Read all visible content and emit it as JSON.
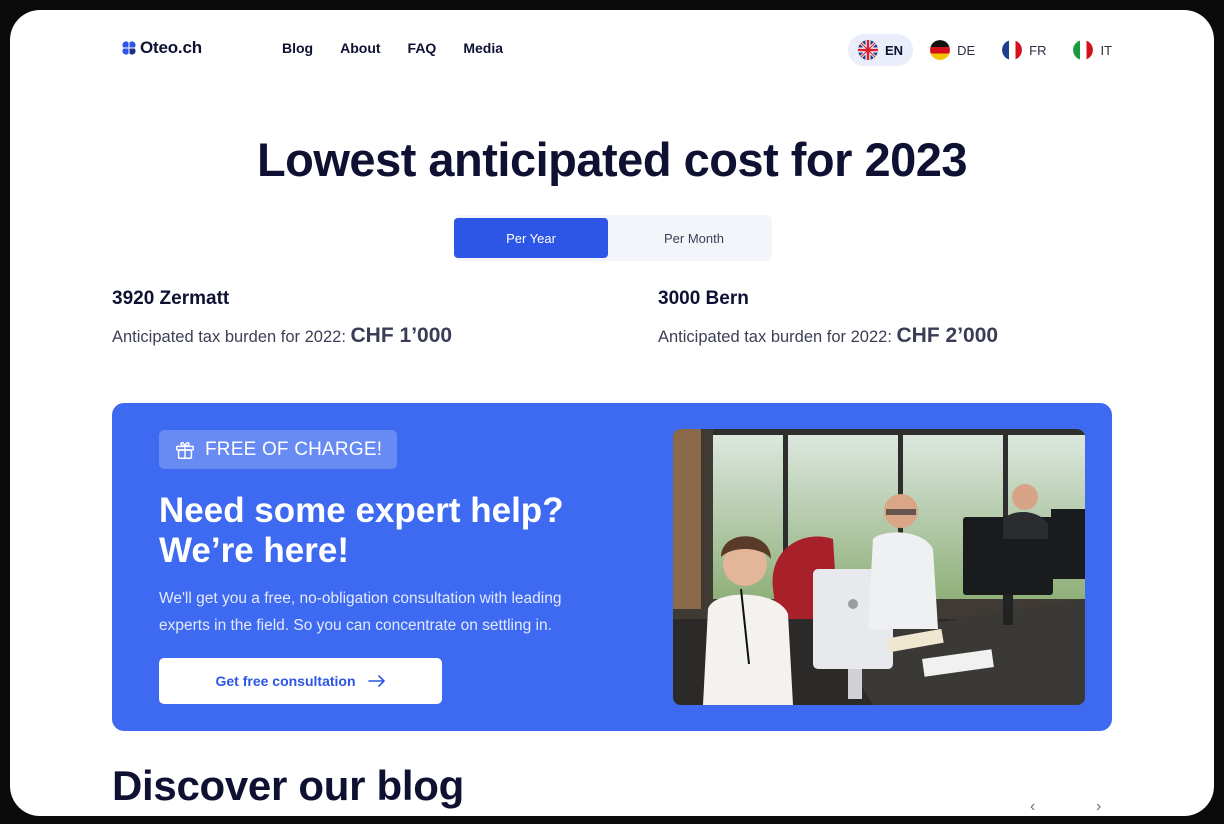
{
  "header": {
    "logo_text": "Oteo.ch",
    "nav": [
      "Blog",
      "About",
      "FAQ",
      "Media"
    ],
    "languages": [
      {
        "code": "EN",
        "active": true
      },
      {
        "code": "DE",
        "active": false
      },
      {
        "code": "FR",
        "active": false
      },
      {
        "code": "IT",
        "active": false
      }
    ]
  },
  "hero": {
    "title": "Lowest anticipated cost for 2023",
    "toggle": {
      "per_year": "Per Year",
      "per_month": "Per Month",
      "selected": "Per Year"
    }
  },
  "locations": [
    {
      "name": "3920 Zermatt",
      "label": "Anticipated tax burden for 2022:",
      "amount": "CHF 1’000"
    },
    {
      "name": "3000 Bern",
      "label": "Anticipated tax burden for 2022:",
      "amount": "CHF 2’000"
    }
  ],
  "banner": {
    "badge": "FREE OF CHARGE!",
    "title_line1": "Need some expert help?",
    "title_line2": "We’re here!",
    "description_line1": "We'll get you a free, no-obligation consultation with leading",
    "description_line2": "experts in the field. So you can concentrate on settling in.",
    "cta": "Get free consultation",
    "accent": "#3d6af0"
  },
  "blog": {
    "title": "Discover our blog"
  },
  "icons": {
    "gift": "gift-icon",
    "arrow_right": "arrow-right-icon",
    "chevron_left": "chevron-left-icon",
    "chevron_right": "chevron-right-icon"
  },
  "colors": {
    "primary": "#2d55e6",
    "text": "#0f1133",
    "lang_active_bg": "#e9eefa"
  }
}
